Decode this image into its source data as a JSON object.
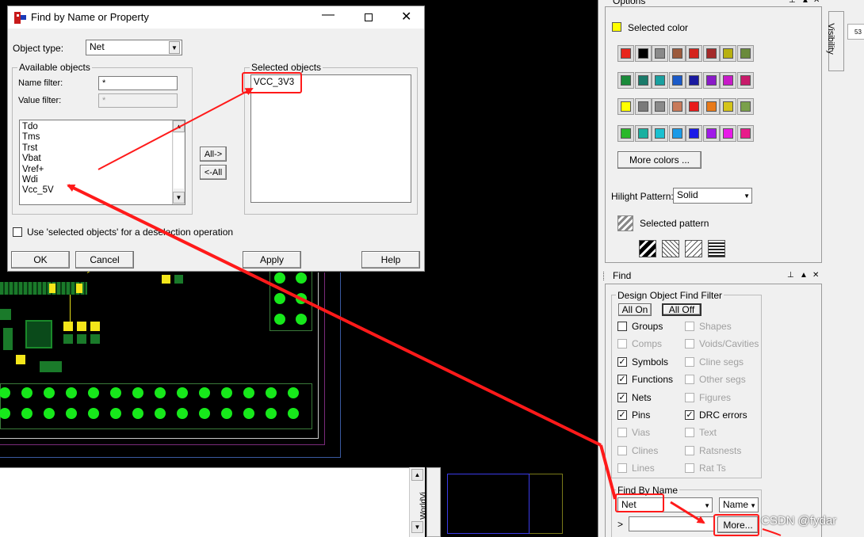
{
  "dialog": {
    "title": "Find by Name or Property",
    "object_type_label": "Object type:",
    "object_type_value": "Net",
    "available_title": "Available objects",
    "name_filter_label": "Name filter:",
    "name_filter_value": "*",
    "value_filter_label": "Value filter:",
    "value_filter_value": "*",
    "available_list": [
      "Tdo",
      "Tms",
      "Trst",
      "Vbat",
      "Vref+",
      "Wdi",
      "Vcc_5V"
    ],
    "all_right": "All->",
    "all_left": "<-All",
    "selected_title": "Selected objects",
    "selected_list": [
      "VCC_3V3"
    ],
    "deselect_label": "Use 'selected objects' for a deselection operation",
    "ok": "OK",
    "cancel": "Cancel",
    "apply": "Apply",
    "help": "Help"
  },
  "options_panel": {
    "title": "Options",
    "side_tab": "Visibility",
    "selected_color_label": "Selected color",
    "selected_color": "#ffff00",
    "color_rows": [
      [
        "#e8261c",
        "#000000",
        "#8a8a8a",
        "#9c5a3c",
        "#d4241c",
        "#a42a2a",
        "#b8b010",
        "#6a8a3a"
      ],
      [
        "#1a8a3a",
        "#1a7a6a",
        "#1aa0a0",
        "#1a5ac8",
        "#1a1aa0",
        "#8a1ac8",
        "#c81ac8",
        "#c81a6a"
      ],
      [
        "#ffff00",
        "#7a7a7a",
        "#8a8a8a",
        "#c87a5a",
        "#e81a1a",
        "#e87a1a",
        "#d4c41a",
        "#7aa04a"
      ],
      [
        "#2ab82a",
        "#1ab0a0",
        "#1ac0d0",
        "#1a9ae8",
        "#1a1ae8",
        "#a01ae8",
        "#e81ae8",
        "#e81a8a"
      ]
    ],
    "more_colors": "More colors ...",
    "hilight_pattern_label": "Hilight Pattern:",
    "hilight_pattern_value": "Solid",
    "selected_pattern_label": "Selected pattern"
  },
  "find_panel": {
    "title": "Find",
    "filter_title": "Design Object Find Filter",
    "all_on": "All On",
    "all_off": "All Off",
    "left_items": [
      {
        "label": "Groups",
        "checked": false,
        "enabled": true
      },
      {
        "label": "Comps",
        "checked": false,
        "enabled": false
      },
      {
        "label": "Symbols",
        "checked": true,
        "enabled": true
      },
      {
        "label": "Functions",
        "checked": true,
        "enabled": true
      },
      {
        "label": "Nets",
        "checked": true,
        "enabled": true
      },
      {
        "label": "Pins",
        "checked": true,
        "enabled": true
      },
      {
        "label": "Vias",
        "checked": false,
        "enabled": false
      },
      {
        "label": "Clines",
        "checked": false,
        "enabled": false
      },
      {
        "label": "Lines",
        "checked": false,
        "enabled": false
      }
    ],
    "right_items": [
      {
        "label": "Shapes",
        "checked": false,
        "enabled": false
      },
      {
        "label": "Voids/Cavities",
        "checked": false,
        "enabled": false
      },
      {
        "label": "Cline segs",
        "checked": false,
        "enabled": false
      },
      {
        "label": "Other segs",
        "checked": false,
        "enabled": false
      },
      {
        "label": "Figures",
        "checked": false,
        "enabled": false
      },
      {
        "label": "DRC errors",
        "checked": true,
        "enabled": true
      },
      {
        "label": "Text",
        "checked": false,
        "enabled": false
      },
      {
        "label": "Ratsnests",
        "checked": false,
        "enabled": false
      },
      {
        "label": "Rat Ts",
        "checked": false,
        "enabled": false
      }
    ],
    "find_by_name_title": "Find By Name",
    "type_value": "Net",
    "mode_value": "Name",
    "prompt": ">",
    "more": "More..."
  },
  "worldview_label": "WorldVi",
  "ruler_text": "53",
  "watermark": "CSDN @fydar"
}
